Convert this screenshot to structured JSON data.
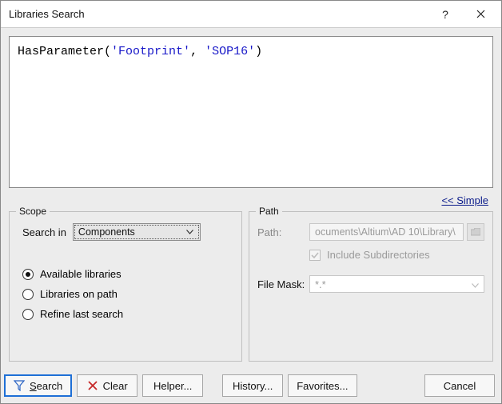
{
  "window": {
    "title": "Libraries Search"
  },
  "query": {
    "fn": "HasParameter",
    "arg1": "'Footprint'",
    "arg2": "'SOP16'"
  },
  "link": {
    "simple": "<< Simple"
  },
  "scope": {
    "legend": "Scope",
    "search_in_label": "Search in",
    "search_in_value": "Components",
    "radios": {
      "available": "Available libraries",
      "onpath": "Libraries on path",
      "refine": "Refine last search"
    }
  },
  "path": {
    "legend": "Path",
    "path_label": "Path:",
    "path_value": "ocuments\\Altium\\AD 10\\Library\\",
    "include_label": "Include Subdirectories",
    "mask_label": "File Mask:",
    "mask_value": "*.*"
  },
  "buttons": {
    "search": "Search",
    "clear": "Clear",
    "helper": "Helper...",
    "history": "History...",
    "favorites": "Favorites...",
    "cancel": "Cancel"
  }
}
